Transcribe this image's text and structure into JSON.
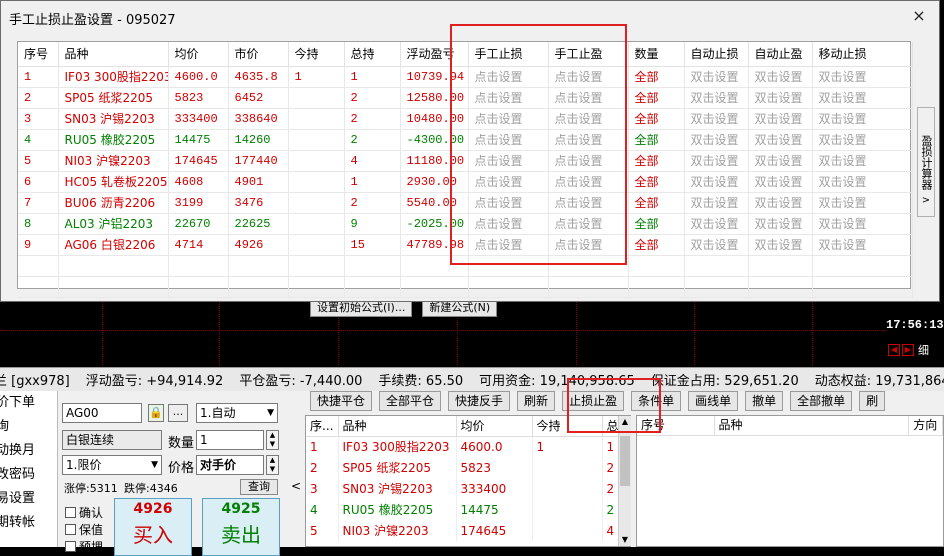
{
  "dialog": {
    "title": "手工止损止盈设置 - 095027",
    "close_label": "×",
    "headers": [
      "序号",
      "品种",
      "均价",
      "市价",
      "今持",
      "总持",
      "浮动盈亏",
      "手工止损",
      "手工止盈",
      "数量",
      "自动止损",
      "自动止盈",
      "移动止损"
    ],
    "rows": [
      {
        "no": "1",
        "name": "IF03 300股指2203",
        "avg": "4600.0",
        "mkt": "4635.8",
        "today": "1",
        "total": "1",
        "pnl": "10739.94",
        "stop": "点击设置",
        "take": "点击设置",
        "qty": "全部",
        "astop": "双击设置",
        "atake": "双击设置",
        "trail": "双击设置",
        "color": "red"
      },
      {
        "no": "2",
        "name": "SP05 纸浆2205",
        "avg": "5823",
        "mkt": "6452",
        "today": "",
        "total": "2",
        "pnl": "12580.00",
        "stop": "点击设置",
        "take": "点击设置",
        "qty": "全部",
        "astop": "双击设置",
        "atake": "双击设置",
        "trail": "双击设置",
        "color": "red"
      },
      {
        "no": "3",
        "name": "SN03 沪锡2203",
        "avg": "333400",
        "mkt": "338640",
        "today": "",
        "total": "2",
        "pnl": "10480.00",
        "stop": "点击设置",
        "take": "点击设置",
        "qty": "全部",
        "astop": "双击设置",
        "atake": "双击设置",
        "trail": "双击设置",
        "color": "red"
      },
      {
        "no": "4",
        "name": "RU05 橡胶2205",
        "avg": "14475",
        "mkt": "14260",
        "today": "",
        "total": "2",
        "pnl": "-4300.00",
        "stop": "点击设置",
        "take": "点击设置",
        "qty": "全部",
        "astop": "双击设置",
        "atake": "双击设置",
        "trail": "双击设置",
        "color": "green"
      },
      {
        "no": "5",
        "name": "NI03 沪镍2203",
        "avg": "174645",
        "mkt": "177440",
        "today": "",
        "total": "4",
        "pnl": "11180.00",
        "stop": "点击设置",
        "take": "点击设置",
        "qty": "全部",
        "astop": "双击设置",
        "atake": "双击设置",
        "trail": "双击设置",
        "color": "red"
      },
      {
        "no": "6",
        "name": "HC05 轧卷板2205",
        "avg": "4608",
        "mkt": "4901",
        "today": "",
        "total": "1",
        "pnl": "2930.00",
        "stop": "点击设置",
        "take": "点击设置",
        "qty": "全部",
        "astop": "双击设置",
        "atake": "双击设置",
        "trail": "双击设置",
        "color": "red"
      },
      {
        "no": "7",
        "name": "BU06 沥青2206",
        "avg": "3199",
        "mkt": "3476",
        "today": "",
        "total": "2",
        "pnl": "5540.00",
        "stop": "点击设置",
        "take": "点击设置",
        "qty": "全部",
        "astop": "双击设置",
        "atake": "双击设置",
        "trail": "双击设置",
        "color": "red"
      },
      {
        "no": "8",
        "name": "AL03 沪铝2203",
        "avg": "22670",
        "mkt": "22625",
        "today": "",
        "total": "9",
        "pnl": "-2025.00",
        "stop": "点击设置",
        "take": "点击设置",
        "qty": "全部",
        "astop": "双击设置",
        "atake": "双击设置",
        "trail": "双击设置",
        "color": "green"
      },
      {
        "no": "9",
        "name": "AG06 白银2206",
        "avg": "4714",
        "mkt": "4926",
        "today": "",
        "total": "15",
        "pnl": "47789.98",
        "stop": "点击设置",
        "take": "点击设置",
        "qty": "全部",
        "astop": "双击设置",
        "atake": "双击设置",
        "trail": "双击设置",
        "color": "red"
      }
    ],
    "side_calc": "盈损计算器",
    "side_arrow": ">"
  },
  "background": {
    "formula_buttons": [
      "设置初始公式(I)...",
      "新建公式(N)"
    ],
    "time": "17:56:13:",
    "ctrl_label": "细"
  },
  "status": {
    "account": "兰 [gxx978]",
    "float_pnl": "浮动盈亏: +94,914.92",
    "close_pnl": "平仓盈亏: -7,440.00",
    "fee": "手续费: 65.50",
    "available": "可用资金: 19,140,958.65",
    "margin": "保证金占用: 529,651.20",
    "equity": "动态权益: 19,731,864.80"
  },
  "left_menu": [
    "价下单",
    "询",
    "动换月",
    "改密码",
    "易设置",
    "期转帐"
  ],
  "order_form": {
    "contract": "AG00",
    "lock_icon": "lock-icon",
    "more": "...",
    "mode": "1.自动",
    "name": "白银连续",
    "qty_label": "数量",
    "qty": "1",
    "price_type": "1.限价",
    "price_label": "价格",
    "price": "对手价",
    "limit_up": "涨停:5311",
    "limit_down": "跌停:4346",
    "query": "查询",
    "checks": [
      "确认",
      "保值",
      "预埋"
    ],
    "buy_price": "4926",
    "buy_label": "买入",
    "sell_price": "4925",
    "sell_label": "卖出"
  },
  "toolbar": [
    "快捷平仓",
    "全部平仓",
    "快捷反手",
    "刷新",
    "止损止盈",
    "条件单",
    "画线单",
    "撤单",
    "全部撤单",
    "刷"
  ],
  "positions": {
    "headers": [
      "序...",
      "品种",
      "均价",
      "今持",
      "总"
    ],
    "rows": [
      {
        "no": "1",
        "name": "IF03 300股指2203",
        "avg": "4600.0",
        "today": "1",
        "total": "1",
        "color": "red"
      },
      {
        "no": "2",
        "name": "SP05 纸浆2205",
        "avg": "5823",
        "today": "",
        "total": "2",
        "color": "red"
      },
      {
        "no": "3",
        "name": "SN03 沪锡2203",
        "avg": "333400",
        "today": "",
        "total": "2",
        "color": "red"
      },
      {
        "no": "4",
        "name": "RU05 橡胶2205",
        "avg": "14475",
        "today": "",
        "total": "2",
        "color": "green"
      },
      {
        "no": "5",
        "name": "NI03 沪镍2203",
        "avg": "174645",
        "today": "",
        "total": "4",
        "color": "red"
      }
    ]
  },
  "orders": {
    "headers": [
      "序号",
      "品种",
      "方向"
    ]
  },
  "colors": {
    "profit": "#d00000",
    "loss": "#008000",
    "highlight": "#e02020"
  }
}
